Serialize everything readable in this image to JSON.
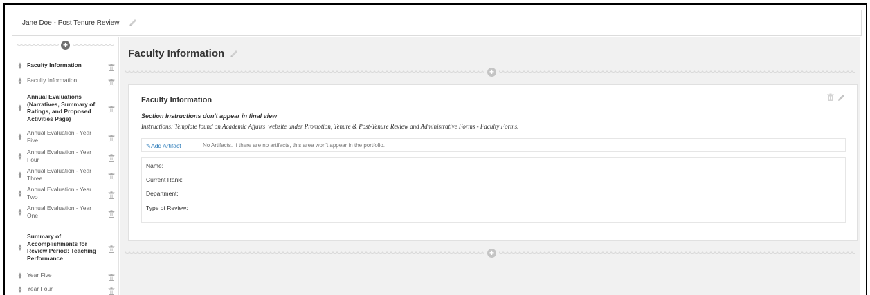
{
  "header": {
    "title": "Jane Doe - Post Tenure Review",
    "edit_icon": "pencil-icon"
  },
  "sidebar": {
    "add_icon": "plus-circle-icon",
    "items": [
      {
        "label": "Faculty Information",
        "bold": true
      },
      {
        "label": "Faculty Information",
        "bold": false
      },
      {
        "label": "Annual Evaluations (Narratives, Summary of Ratings, and Proposed Activities Page)",
        "bold": true
      },
      {
        "label": "Annual Evaluation - Year Five",
        "bold": false
      },
      {
        "label": "Annual Evaluation - Year Four",
        "bold": false
      },
      {
        "label": "Annual Evaluation - Year Three",
        "bold": false
      },
      {
        "label": "Annual Evaluation - Year Two",
        "bold": false
      },
      {
        "label": "Annual Evaluation - Year One",
        "bold": false
      },
      {
        "label": "Summary of Accomplishments for Review Period: Teaching Performance",
        "bold": true
      },
      {
        "label": "Year Five",
        "bold": false
      },
      {
        "label": "Year Four",
        "bold": false
      }
    ]
  },
  "main": {
    "section_title": "Faculty Information",
    "card": {
      "title": "Faculty Information",
      "instructions_heading": "Section Instructions don't appear in final view",
      "instructions_text": "Instructions: Template found on Academic Affairs' website under Promotion, Tenure & Post-Tenure Review and Administrative Forms - Faculty Forms.",
      "add_artifact_label": "Add Artifact",
      "artifact_note": "No Artifacts. If there are no artifacts, this area won't appear in the portfolio.",
      "fields": [
        "Name:",
        "Current Rank:",
        "Department:",
        "Type of Review:"
      ]
    }
  },
  "colors": {
    "link": "#2b7bb9",
    "background": "#f1f1f1",
    "icon_gray": "#bdbdbd"
  }
}
